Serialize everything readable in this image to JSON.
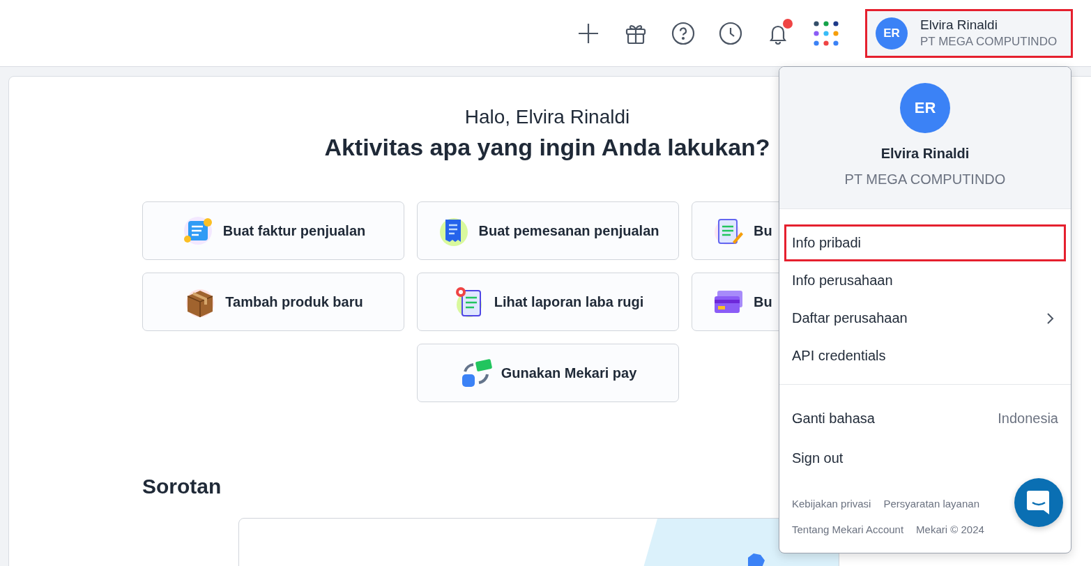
{
  "top_bar": {
    "notification_badge": true,
    "user": {
      "initials": "ER",
      "name": "Elvira Rinaldi",
      "company": "PT MEGA COMPUTINDO",
      "highlighted": true
    }
  },
  "greeting": {
    "hello": "Halo, Elvira Rinaldi",
    "question": "Aktivitas apa yang ingin Anda lakukan?"
  },
  "actions": [
    {
      "label": "Buat faktur penjualan",
      "kind": "full"
    },
    {
      "label": "Buat pemesanan penjualan",
      "kind": "full"
    },
    {
      "label": "Bu",
      "kind": "cut"
    },
    {
      "label": "Tambah produk baru",
      "kind": "full"
    },
    {
      "label": "Lihat laporan laba rugi",
      "kind": "full"
    },
    {
      "label": "Bu",
      "kind": "cut"
    },
    {
      "label": "Gunakan Mekari pay",
      "kind": "full"
    }
  ],
  "highlights": {
    "title": "Sorotan"
  },
  "account_menu": {
    "initials": "ER",
    "name": "Elvira Rinaldi",
    "company": "PT MEGA COMPUTINDO",
    "items": [
      {
        "label": "Info pribadi",
        "highlighted": true,
        "submenu": false
      },
      {
        "label": "Info perusahaan",
        "highlighted": false,
        "submenu": false
      },
      {
        "label": "Daftar perusahaan",
        "highlighted": false,
        "submenu": true
      },
      {
        "label": "API credentials",
        "highlighted": false,
        "submenu": false
      }
    ],
    "language": {
      "label": "Ganti bahasa",
      "value": "Indonesia"
    },
    "sign_out": "Sign out",
    "footer_links": [
      "Kebijakan privasi",
      "Persyaratan layanan",
      "Tentang Mekari Account",
      "Mekari © 2024"
    ]
  }
}
